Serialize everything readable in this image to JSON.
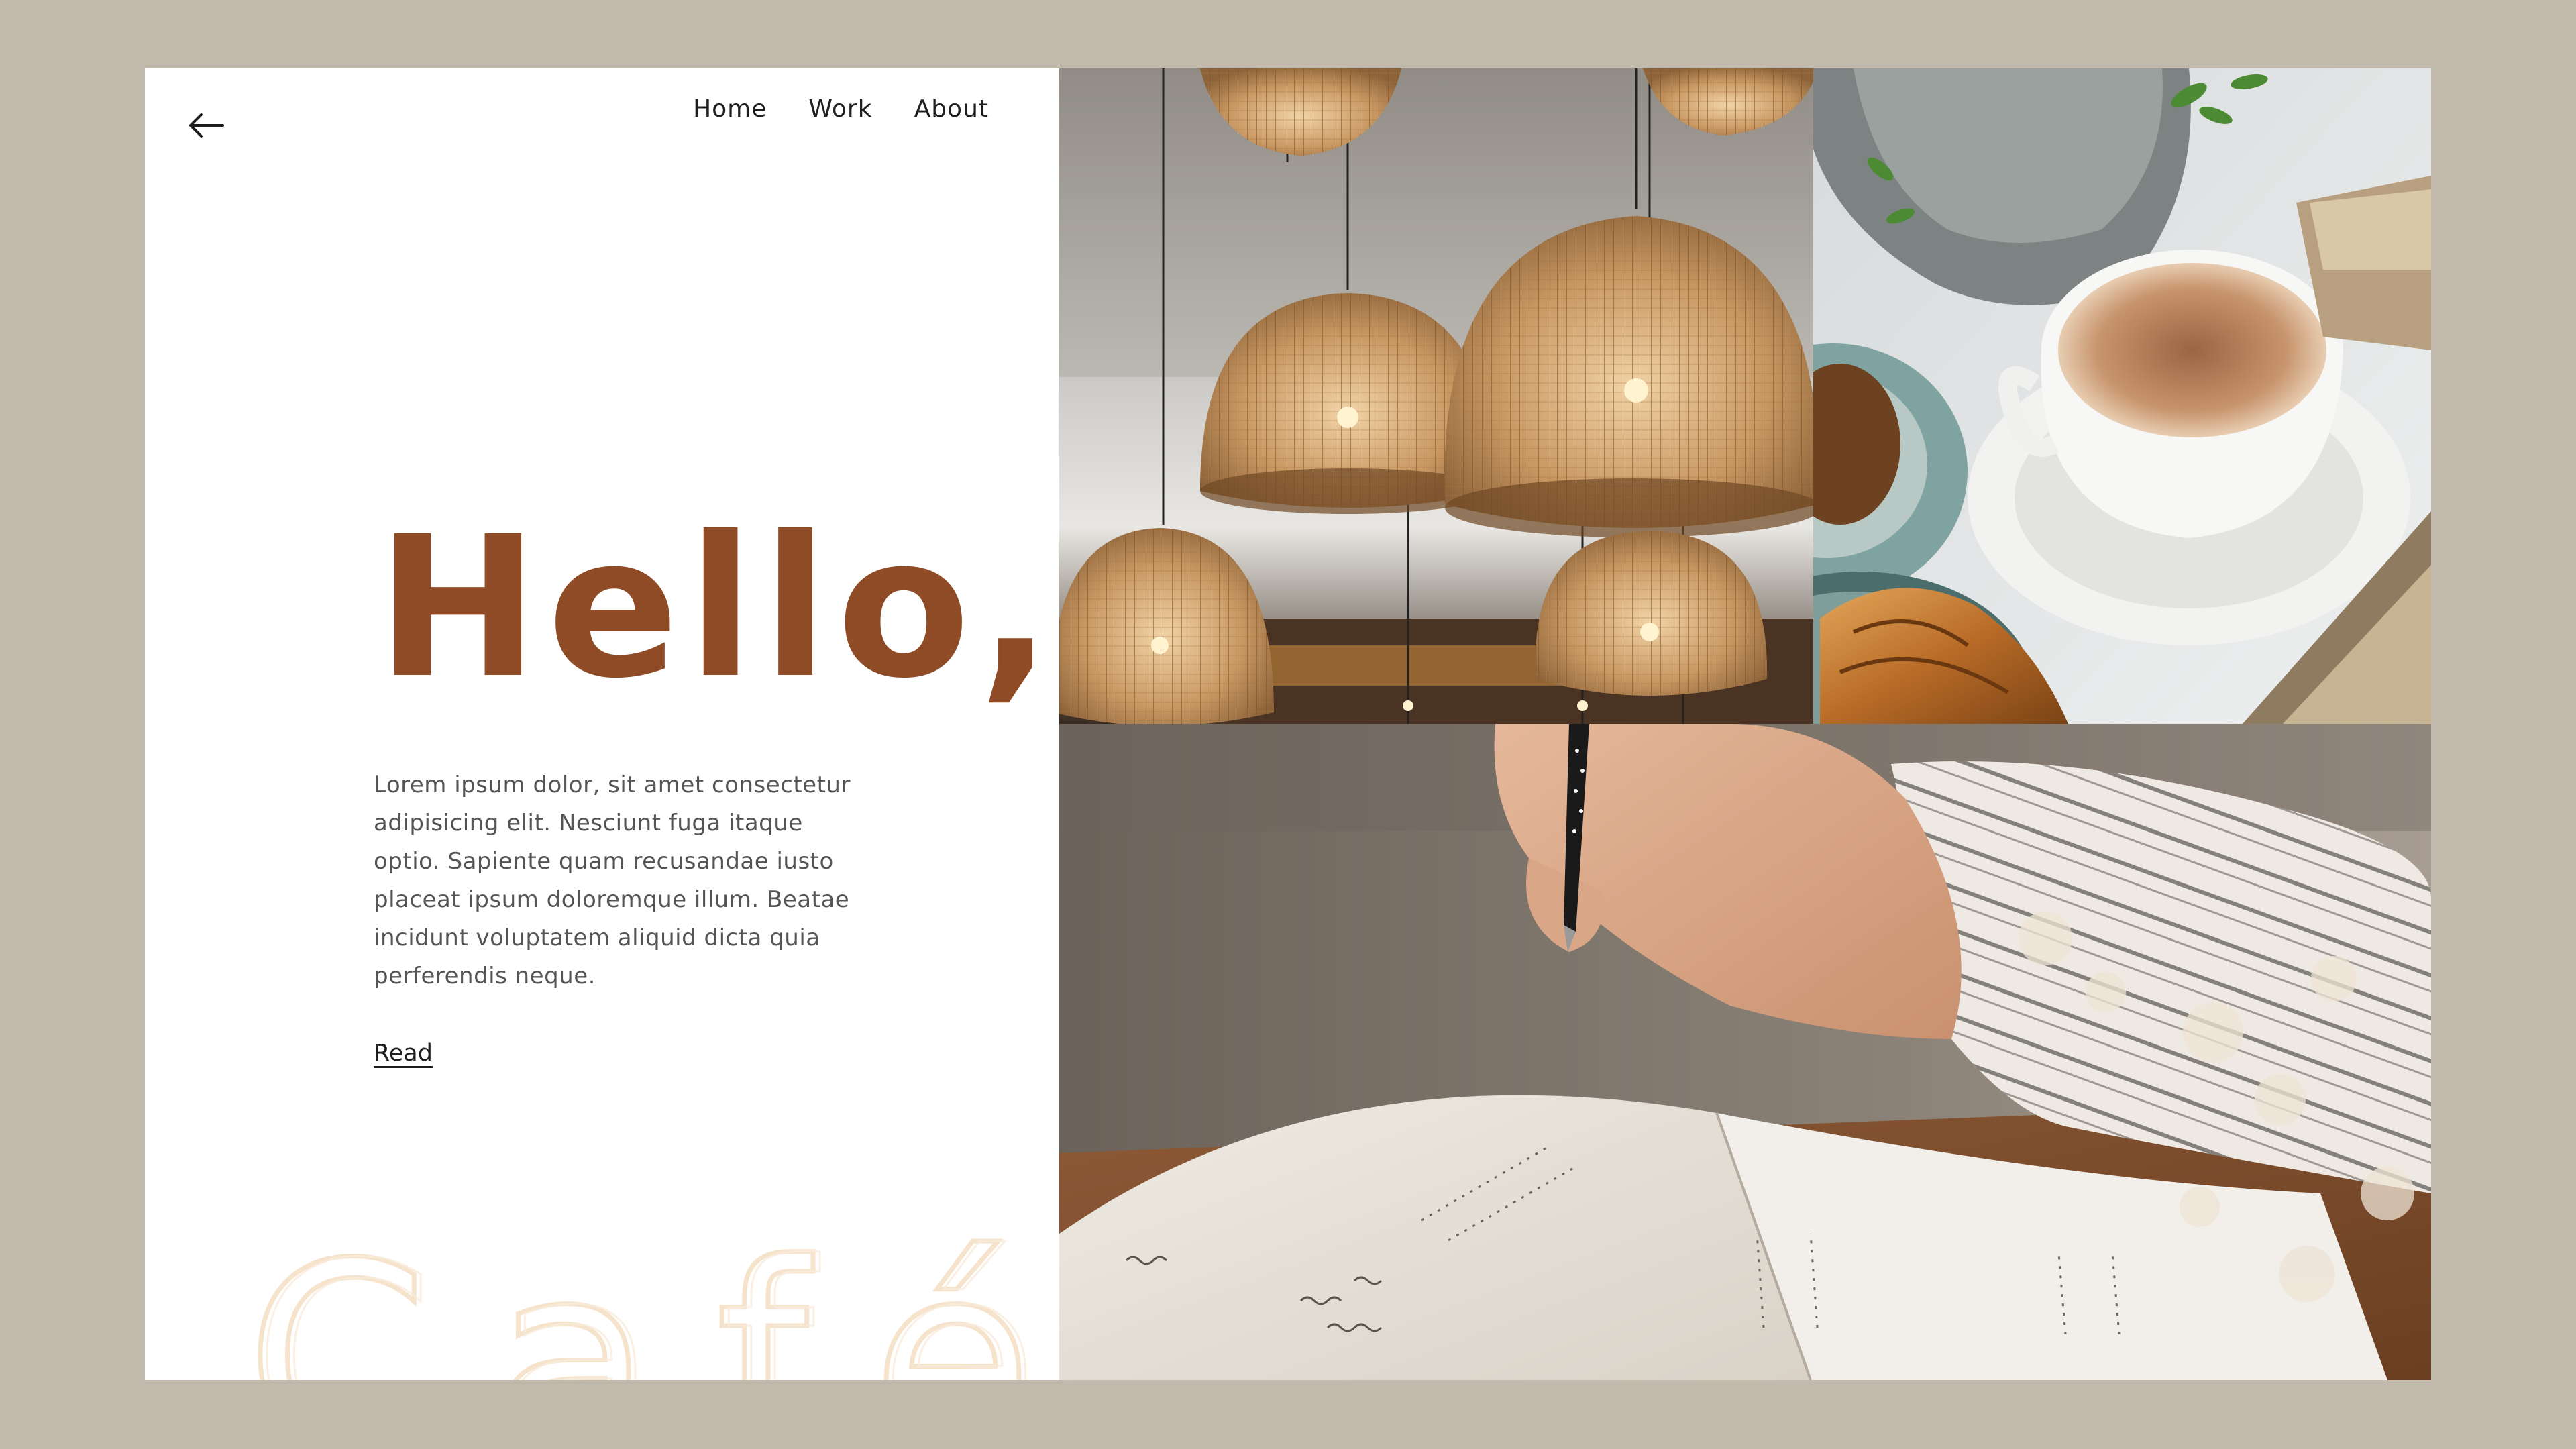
{
  "header": {
    "back_icon": "arrow-left-icon",
    "nav": [
      "Home",
      "Work",
      "About"
    ]
  },
  "hero": {
    "title": "Hello,",
    "body": "Lorem ipsum dolor, sit amet consectetur adipisicing elit. Nesciunt fuga itaque optio. Sapiente quam recusandae iusto placeat ipsum doloremque illum. Beatae incidunt voluptatem aliquid dicta quia perferendis neque.",
    "read_label": "Read",
    "watermark": "Café"
  },
  "colors": {
    "page_bg": "#c2b9ad",
    "accent": "#8e4b25",
    "watermark": "#f6e3cc"
  },
  "images": {
    "top_left": "rattan-pendant-lamps-photo",
    "top_right": "cappuccino-and-croissant-photo",
    "bottom": "hand-writing-in-notebook-photo"
  }
}
